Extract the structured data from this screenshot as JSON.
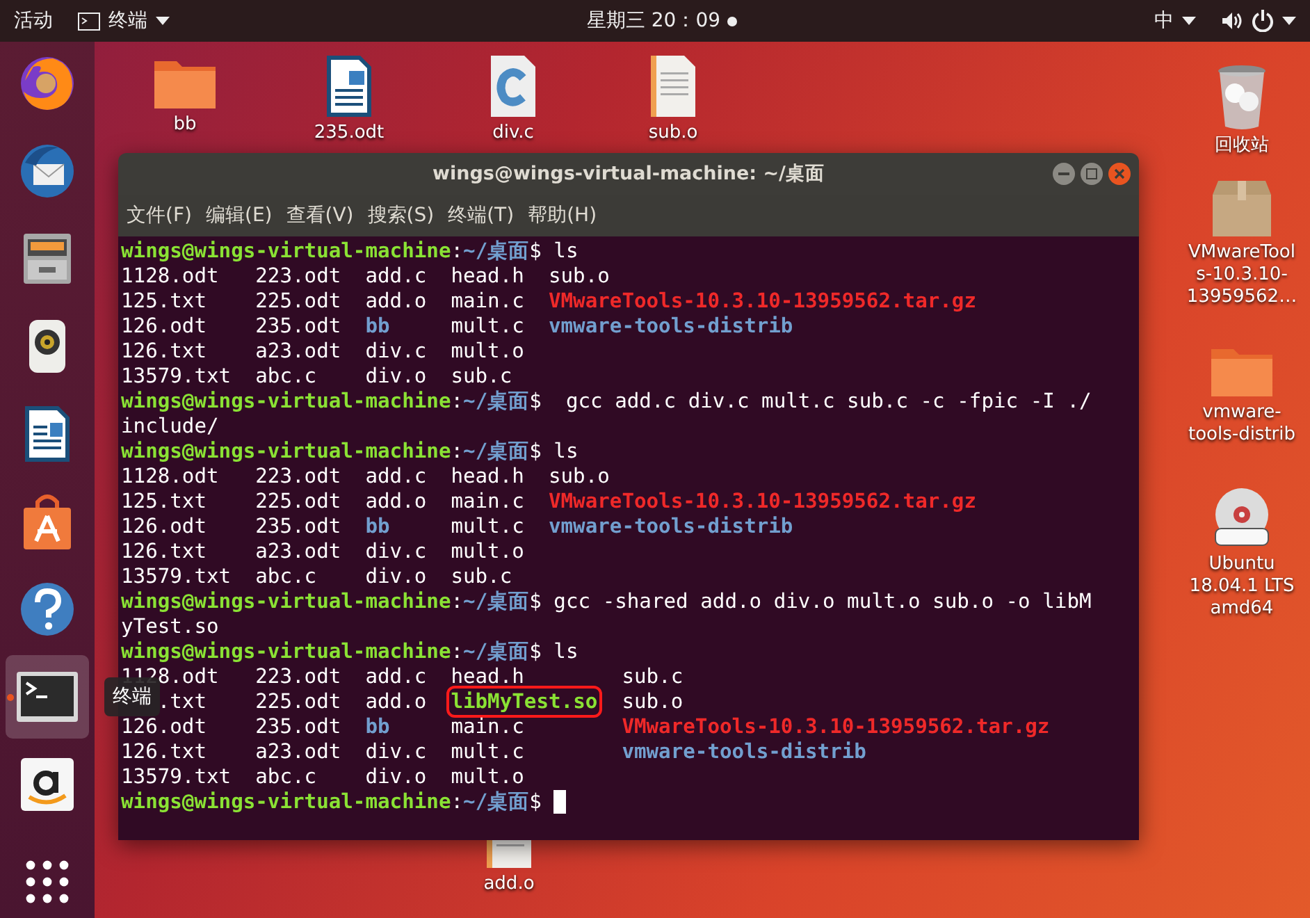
{
  "top_bar": {
    "activities": "活动",
    "app_menu": {
      "label": "终端"
    },
    "clock": "星期三 20：09",
    "notification": true,
    "input_method": "中"
  },
  "dock": {
    "items": [
      {
        "kind": "browser",
        "selected": false,
        "running": false
      },
      {
        "kind": "mail",
        "selected": false,
        "running": false
      },
      {
        "kind": "files",
        "selected": false,
        "running": false
      },
      {
        "kind": "music",
        "selected": false,
        "running": false
      },
      {
        "kind": "writer",
        "selected": false,
        "running": false
      },
      {
        "kind": "store",
        "selected": false,
        "running": false
      },
      {
        "kind": "help",
        "selected": false,
        "running": false
      },
      {
        "kind": "terminal",
        "selected": true,
        "running": true
      },
      {
        "kind": "shop",
        "selected": false,
        "running": false
      }
    ],
    "tooltip": "终端"
  },
  "desktop_icons": [
    {
      "kind": "folder",
      "label": "bb"
    },
    {
      "kind": "odt",
      "label": "235.odt"
    },
    {
      "kind": "csrc",
      "label": "div.c"
    },
    {
      "kind": "text",
      "label": "sub.o"
    },
    {
      "kind": "trash",
      "label": "回收站"
    },
    {
      "kind": "archive",
      "label": "VMwareTools-10.3.10-13959562…"
    },
    {
      "kind": "folder",
      "label": "vmware-tools-distrib"
    },
    {
      "kind": "dvd",
      "label": "Ubuntu 18.04.1 LTS amd64"
    },
    {
      "kind": "text",
      "label": "add.o"
    }
  ],
  "terminal": {
    "title": "wings@wings-virtual-machine: ~/桌面",
    "menu": [
      "文件(F)",
      "编辑(E)",
      "查看(V)",
      "搜索(S)",
      "终端(T)",
      "帮助(H)"
    ],
    "lines": [
      {
        "kind": "prompt",
        "user": "wings@wings-virtual-machine",
        "separator": ":",
        "path": "~/桌面",
        "command": "$ ls",
        "cursor": false
      },
      {
        "kind": "listing",
        "cells": [
          {
            "text": "1128.odt",
            "kind": "file"
          },
          {
            "text": "223.odt",
            "kind": "file"
          },
          {
            "text": "add.c",
            "kind": "file"
          },
          {
            "text": "head.h",
            "kind": "file"
          },
          {
            "text": "sub.o",
            "kind": "file"
          }
        ]
      },
      {
        "kind": "listing",
        "cells": [
          {
            "text": "125.txt",
            "kind": "file"
          },
          {
            "text": "225.odt",
            "kind": "file"
          },
          {
            "text": "add.o",
            "kind": "file"
          },
          {
            "text": "main.c",
            "kind": "file"
          },
          {
            "text": "VMwareTools-10.3.10-13959562.tar.gz",
            "kind": "archive"
          }
        ]
      },
      {
        "kind": "listing",
        "cells": [
          {
            "text": "126.odt",
            "kind": "file"
          },
          {
            "text": "235.odt",
            "kind": "file"
          },
          {
            "text": "bb",
            "kind": "dir"
          },
          {
            "text": "mult.c",
            "kind": "file"
          },
          {
            "text": "vmware-tools-distrib",
            "kind": "dir"
          }
        ]
      },
      {
        "kind": "listing",
        "cells": [
          {
            "text": "126.txt",
            "kind": "file"
          },
          {
            "text": "a23.odt",
            "kind": "file"
          },
          {
            "text": "div.c",
            "kind": "file"
          },
          {
            "text": "mult.o",
            "kind": "file"
          }
        ]
      },
      {
        "kind": "listing",
        "cells": [
          {
            "text": "13579.txt",
            "kind": "file"
          },
          {
            "text": "abc.c",
            "kind": "file"
          },
          {
            "text": "div.o",
            "kind": "file"
          },
          {
            "text": "sub.c",
            "kind": "file"
          }
        ]
      },
      {
        "kind": "prompt",
        "user": "wings@wings-virtual-machine",
        "separator": ":",
        "path": "~/桌面",
        "command": "$  gcc add.c div.c mult.c sub.c -c -fpic -I ./",
        "cursor": false
      },
      {
        "kind": "text",
        "text": "include/"
      },
      {
        "kind": "prompt",
        "user": "wings@wings-virtual-machine",
        "separator": ":",
        "path": "~/桌面",
        "command": "$ ls",
        "cursor": false
      },
      {
        "kind": "listing",
        "cells": [
          {
            "text": "1128.odt",
            "kind": "file"
          },
          {
            "text": "223.odt",
            "kind": "file"
          },
          {
            "text": "add.c",
            "kind": "file"
          },
          {
            "text": "head.h",
            "kind": "file"
          },
          {
            "text": "sub.o",
            "kind": "file"
          }
        ]
      },
      {
        "kind": "listing",
        "cells": [
          {
            "text": "125.txt",
            "kind": "file"
          },
          {
            "text": "225.odt",
            "kind": "file"
          },
          {
            "text": "add.o",
            "kind": "file"
          },
          {
            "text": "main.c",
            "kind": "file"
          },
          {
            "text": "VMwareTools-10.3.10-13959562.tar.gz",
            "kind": "archive"
          }
        ]
      },
      {
        "kind": "listing",
        "cells": [
          {
            "text": "126.odt",
            "kind": "file"
          },
          {
            "text": "235.odt",
            "kind": "file"
          },
          {
            "text": "bb",
            "kind": "dir"
          },
          {
            "text": "mult.c",
            "kind": "file"
          },
          {
            "text": "vmware-tools-distrib",
            "kind": "dir"
          }
        ]
      },
      {
        "kind": "listing",
        "cells": [
          {
            "text": "126.txt",
            "kind": "file"
          },
          {
            "text": "a23.odt",
            "kind": "file"
          },
          {
            "text": "div.c",
            "kind": "file"
          },
          {
            "text": "mult.o",
            "kind": "file"
          }
        ]
      },
      {
        "kind": "listing",
        "cells": [
          {
            "text": "13579.txt",
            "kind": "file"
          },
          {
            "text": "abc.c",
            "kind": "file"
          },
          {
            "text": "div.o",
            "kind": "file"
          },
          {
            "text": "sub.c",
            "kind": "file"
          }
        ]
      },
      {
        "kind": "prompt",
        "user": "wings@wings-virtual-machine",
        "separator": ":",
        "path": "~/桌面",
        "command": "$ gcc -shared add.o div.o mult.o sub.o -o libM",
        "cursor": false
      },
      {
        "kind": "text",
        "text": "yTest.so"
      },
      {
        "kind": "prompt",
        "user": "wings@wings-virtual-machine",
        "separator": ":",
        "path": "~/桌面",
        "command": "$ ls",
        "cursor": false
      },
      {
        "kind": "listing",
        "cells": [
          {
            "text": "1128.odt",
            "kind": "file"
          },
          {
            "text": "223.odt",
            "kind": "file"
          },
          {
            "text": "add.c",
            "kind": "file"
          },
          {
            "text": "head.h",
            "kind": "file"
          },
          {
            "text": "sub.c",
            "kind": "file"
          }
        ]
      },
      {
        "kind": "listing",
        "cells": [
          {
            "text": ".txt",
            "kind": "file",
            "covered": true
          },
          {
            "text": "225.odt",
            "kind": "file"
          },
          {
            "text": "add.o",
            "kind": "file"
          },
          {
            "text": "libMyTest.so",
            "kind": "lib",
            "highlighted": true
          },
          {
            "text": "sub.o",
            "kind": "file"
          }
        ]
      },
      {
        "kind": "listing",
        "cells": [
          {
            "text": "126.odt",
            "kind": "file"
          },
          {
            "text": "235.odt",
            "kind": "file"
          },
          {
            "text": "bb",
            "kind": "dir"
          },
          {
            "text": "main.c",
            "kind": "file"
          },
          {
            "text": "VMwareTools-10.3.10-13959562.tar.gz",
            "kind": "archive"
          }
        ]
      },
      {
        "kind": "listing",
        "cells": [
          {
            "text": "126.txt",
            "kind": "file"
          },
          {
            "text": "a23.odt",
            "kind": "file"
          },
          {
            "text": "div.c",
            "kind": "file"
          },
          {
            "text": "mult.c",
            "kind": "file"
          },
          {
            "text": "vmware-tools-distrib",
            "kind": "dir"
          }
        ]
      },
      {
        "kind": "listing",
        "cells": [
          {
            "text": "13579.txt",
            "kind": "file"
          },
          {
            "text": "abc.c",
            "kind": "file"
          },
          {
            "text": "div.o",
            "kind": "file"
          },
          {
            "text": "mult.o",
            "kind": "file"
          }
        ]
      },
      {
        "kind": "prompt",
        "user": "wings@wings-virtual-machine",
        "separator": ":",
        "path": "~/桌面",
        "command": "$",
        "cursor": true
      }
    ]
  }
}
